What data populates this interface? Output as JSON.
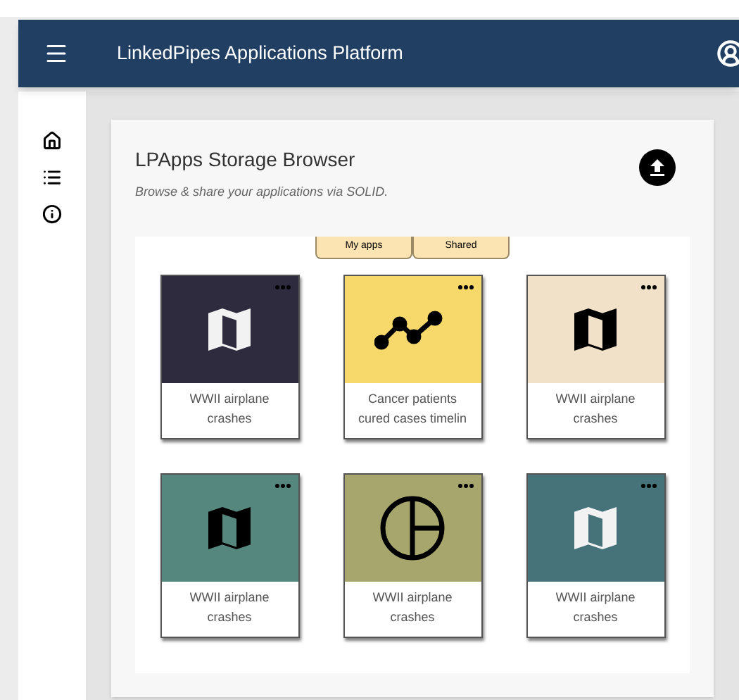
{
  "header": {
    "title": "LinkedPipes Applications Platform"
  },
  "sidebar": {
    "items": [
      {
        "kind": "home"
      },
      {
        "kind": "list"
      },
      {
        "kind": "info"
      }
    ]
  },
  "browser": {
    "title": "LPApps Storage Browser",
    "subtitle": "Browse & share your applications via SOLID."
  },
  "tabs": [
    {
      "label": "My apps"
    },
    {
      "label": "Shared"
    }
  ],
  "tiles": [
    {
      "kind": "map",
      "color": "#2e2b3f",
      "light_icon": true,
      "caption_lines": [
        "WWII airplane",
        "crashes"
      ]
    },
    {
      "kind": "timeline",
      "color": "#f7d96b",
      "light_icon": false,
      "caption_lines": [
        "Cancer patients",
        "cured cases timelin"
      ]
    },
    {
      "kind": "map",
      "color": "#f1e1c8",
      "light_icon": false,
      "caption_lines": [
        "WWII airplane",
        "crashes"
      ]
    },
    {
      "kind": "map",
      "color": "#55877f",
      "light_icon": false,
      "caption_lines": [
        "WWII airplane",
        "crashes"
      ]
    },
    {
      "kind": "pie",
      "color": "#a7a76d",
      "light_icon": false,
      "caption_lines": [
        "WWII airplane",
        "crashes"
      ]
    },
    {
      "kind": "map",
      "color": "#46737a",
      "light_icon": true,
      "caption_lines": [
        "WWII airplane",
        "crashes"
      ]
    }
  ]
}
